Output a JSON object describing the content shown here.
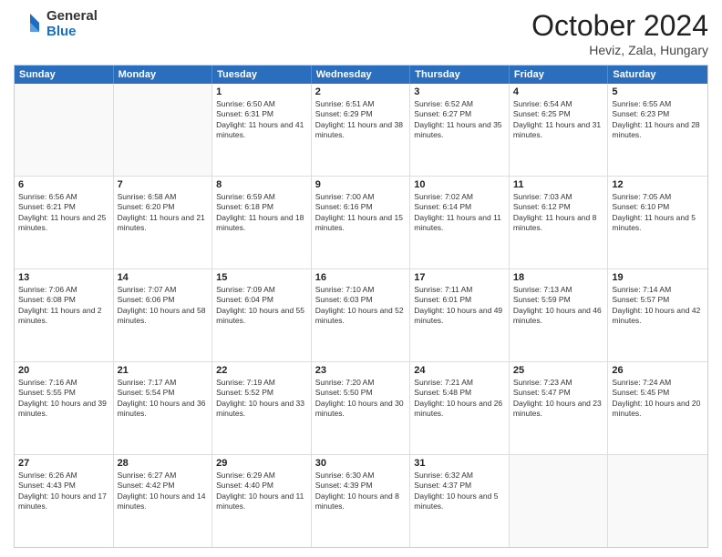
{
  "logo": {
    "general": "General",
    "blue": "Blue"
  },
  "header": {
    "month": "October 2024",
    "location": "Heviz, Zala, Hungary"
  },
  "days": [
    "Sunday",
    "Monday",
    "Tuesday",
    "Wednesday",
    "Thursday",
    "Friday",
    "Saturday"
  ],
  "weeks": [
    [
      {
        "day": "",
        "info": ""
      },
      {
        "day": "",
        "info": ""
      },
      {
        "day": "1",
        "info": "Sunrise: 6:50 AM\nSunset: 6:31 PM\nDaylight: 11 hours and 41 minutes."
      },
      {
        "day": "2",
        "info": "Sunrise: 6:51 AM\nSunset: 6:29 PM\nDaylight: 11 hours and 38 minutes."
      },
      {
        "day": "3",
        "info": "Sunrise: 6:52 AM\nSunset: 6:27 PM\nDaylight: 11 hours and 35 minutes."
      },
      {
        "day": "4",
        "info": "Sunrise: 6:54 AM\nSunset: 6:25 PM\nDaylight: 11 hours and 31 minutes."
      },
      {
        "day": "5",
        "info": "Sunrise: 6:55 AM\nSunset: 6:23 PM\nDaylight: 11 hours and 28 minutes."
      }
    ],
    [
      {
        "day": "6",
        "info": "Sunrise: 6:56 AM\nSunset: 6:21 PM\nDaylight: 11 hours and 25 minutes."
      },
      {
        "day": "7",
        "info": "Sunrise: 6:58 AM\nSunset: 6:20 PM\nDaylight: 11 hours and 21 minutes."
      },
      {
        "day": "8",
        "info": "Sunrise: 6:59 AM\nSunset: 6:18 PM\nDaylight: 11 hours and 18 minutes."
      },
      {
        "day": "9",
        "info": "Sunrise: 7:00 AM\nSunset: 6:16 PM\nDaylight: 11 hours and 15 minutes."
      },
      {
        "day": "10",
        "info": "Sunrise: 7:02 AM\nSunset: 6:14 PM\nDaylight: 11 hours and 11 minutes."
      },
      {
        "day": "11",
        "info": "Sunrise: 7:03 AM\nSunset: 6:12 PM\nDaylight: 11 hours and 8 minutes."
      },
      {
        "day": "12",
        "info": "Sunrise: 7:05 AM\nSunset: 6:10 PM\nDaylight: 11 hours and 5 minutes."
      }
    ],
    [
      {
        "day": "13",
        "info": "Sunrise: 7:06 AM\nSunset: 6:08 PM\nDaylight: 11 hours and 2 minutes."
      },
      {
        "day": "14",
        "info": "Sunrise: 7:07 AM\nSunset: 6:06 PM\nDaylight: 10 hours and 58 minutes."
      },
      {
        "day": "15",
        "info": "Sunrise: 7:09 AM\nSunset: 6:04 PM\nDaylight: 10 hours and 55 minutes."
      },
      {
        "day": "16",
        "info": "Sunrise: 7:10 AM\nSunset: 6:03 PM\nDaylight: 10 hours and 52 minutes."
      },
      {
        "day": "17",
        "info": "Sunrise: 7:11 AM\nSunset: 6:01 PM\nDaylight: 10 hours and 49 minutes."
      },
      {
        "day": "18",
        "info": "Sunrise: 7:13 AM\nSunset: 5:59 PM\nDaylight: 10 hours and 46 minutes."
      },
      {
        "day": "19",
        "info": "Sunrise: 7:14 AM\nSunset: 5:57 PM\nDaylight: 10 hours and 42 minutes."
      }
    ],
    [
      {
        "day": "20",
        "info": "Sunrise: 7:16 AM\nSunset: 5:55 PM\nDaylight: 10 hours and 39 minutes."
      },
      {
        "day": "21",
        "info": "Sunrise: 7:17 AM\nSunset: 5:54 PM\nDaylight: 10 hours and 36 minutes."
      },
      {
        "day": "22",
        "info": "Sunrise: 7:19 AM\nSunset: 5:52 PM\nDaylight: 10 hours and 33 minutes."
      },
      {
        "day": "23",
        "info": "Sunrise: 7:20 AM\nSunset: 5:50 PM\nDaylight: 10 hours and 30 minutes."
      },
      {
        "day": "24",
        "info": "Sunrise: 7:21 AM\nSunset: 5:48 PM\nDaylight: 10 hours and 26 minutes."
      },
      {
        "day": "25",
        "info": "Sunrise: 7:23 AM\nSunset: 5:47 PM\nDaylight: 10 hours and 23 minutes."
      },
      {
        "day": "26",
        "info": "Sunrise: 7:24 AM\nSunset: 5:45 PM\nDaylight: 10 hours and 20 minutes."
      }
    ],
    [
      {
        "day": "27",
        "info": "Sunrise: 6:26 AM\nSunset: 4:43 PM\nDaylight: 10 hours and 17 minutes."
      },
      {
        "day": "28",
        "info": "Sunrise: 6:27 AM\nSunset: 4:42 PM\nDaylight: 10 hours and 14 minutes."
      },
      {
        "day": "29",
        "info": "Sunrise: 6:29 AM\nSunset: 4:40 PM\nDaylight: 10 hours and 11 minutes."
      },
      {
        "day": "30",
        "info": "Sunrise: 6:30 AM\nSunset: 4:39 PM\nDaylight: 10 hours and 8 minutes."
      },
      {
        "day": "31",
        "info": "Sunrise: 6:32 AM\nSunset: 4:37 PM\nDaylight: 10 hours and 5 minutes."
      },
      {
        "day": "",
        "info": ""
      },
      {
        "day": "",
        "info": ""
      }
    ]
  ]
}
